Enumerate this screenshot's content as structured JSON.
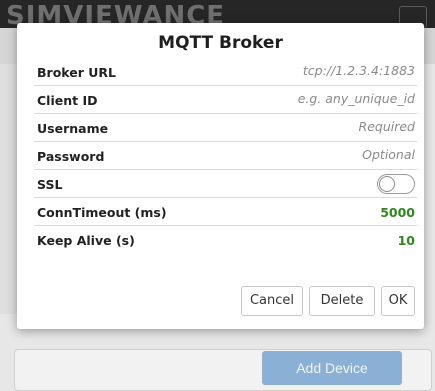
{
  "background": {
    "app_title": "SIMVIEWANCE",
    "add_device_label": "Add Device"
  },
  "dialog": {
    "title": "MQTT Broker",
    "fields": {
      "broker_url": {
        "label": "Broker URL",
        "placeholder": "tcp://1.2.3.4:1883",
        "value": ""
      },
      "client_id": {
        "label": "Client ID",
        "placeholder": "e.g. any_unique_id",
        "value": ""
      },
      "username": {
        "label": "Username",
        "placeholder": "Required",
        "value": ""
      },
      "password": {
        "label": "Password",
        "placeholder": "Optional",
        "value": ""
      },
      "ssl": {
        "label": "SSL",
        "enabled": false
      },
      "conn_timeout": {
        "label": "ConnTimeout (ms)",
        "value": "5000"
      },
      "keep_alive": {
        "label": "Keep Alive (s)",
        "value": "10"
      }
    },
    "buttons": {
      "cancel": "Cancel",
      "delete": "Delete",
      "ok": "OK"
    }
  },
  "colors": {
    "numeric_value": "#2c8a1a",
    "primary_button": "#8ab0d6"
  }
}
